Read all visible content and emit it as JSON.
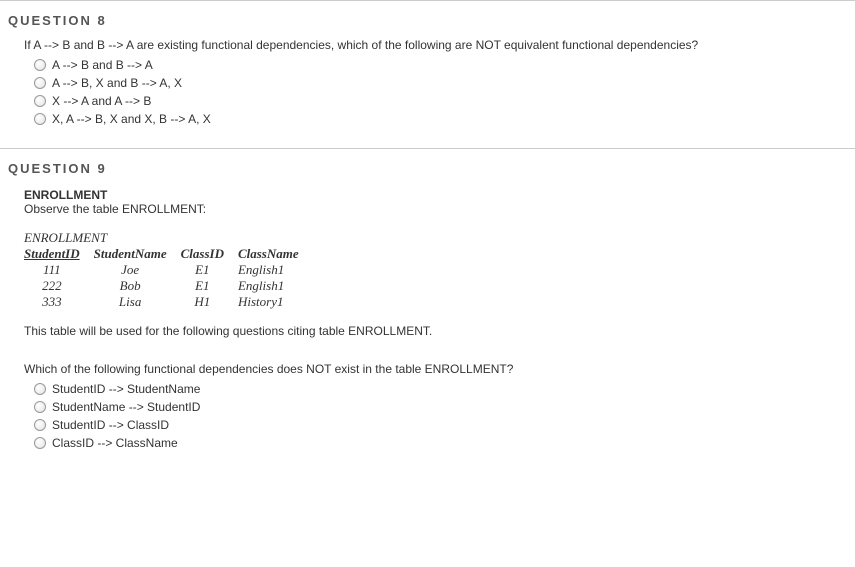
{
  "q8": {
    "heading": "QUESTION 8",
    "prompt": "If A --> B and B --> A are existing functional dependencies, which of the following are NOT equivalent functional dependencies?",
    "options": [
      "A --> B and B --> A",
      "A --> B, X and B --> A, X",
      "X --> A and A --> B",
      "X, A --> B, X and X, B --> A, X"
    ]
  },
  "q9": {
    "heading": "QUESTION 9",
    "subheading": "ENROLLMENT",
    "observe": "Observe the table ENROLLMENT:",
    "table_title": "ENROLLMENT",
    "columns": [
      "StudentID",
      "StudentName",
      "ClassID",
      "ClassName"
    ],
    "rows": [
      {
        "StudentID": "111",
        "StudentName": "Joe",
        "ClassID": "E1",
        "ClassName": "English1"
      },
      {
        "StudentID": "222",
        "StudentName": "Bob",
        "ClassID": "E1",
        "ClassName": "English1"
      },
      {
        "StudentID": "333",
        "StudentName": "Lisa",
        "ClassID": "H1",
        "ClassName": "History1"
      }
    ],
    "note": "This table will be used for the following questions citing table ENROLLMENT.",
    "prompt2": "Which of the following functional dependencies does NOT exist in the table ENROLLMENT?",
    "options": [
      "StudentID --> StudentName",
      "StudentName --> StudentID",
      "StudentID --> ClassID",
      "ClassID --> ClassName"
    ]
  }
}
